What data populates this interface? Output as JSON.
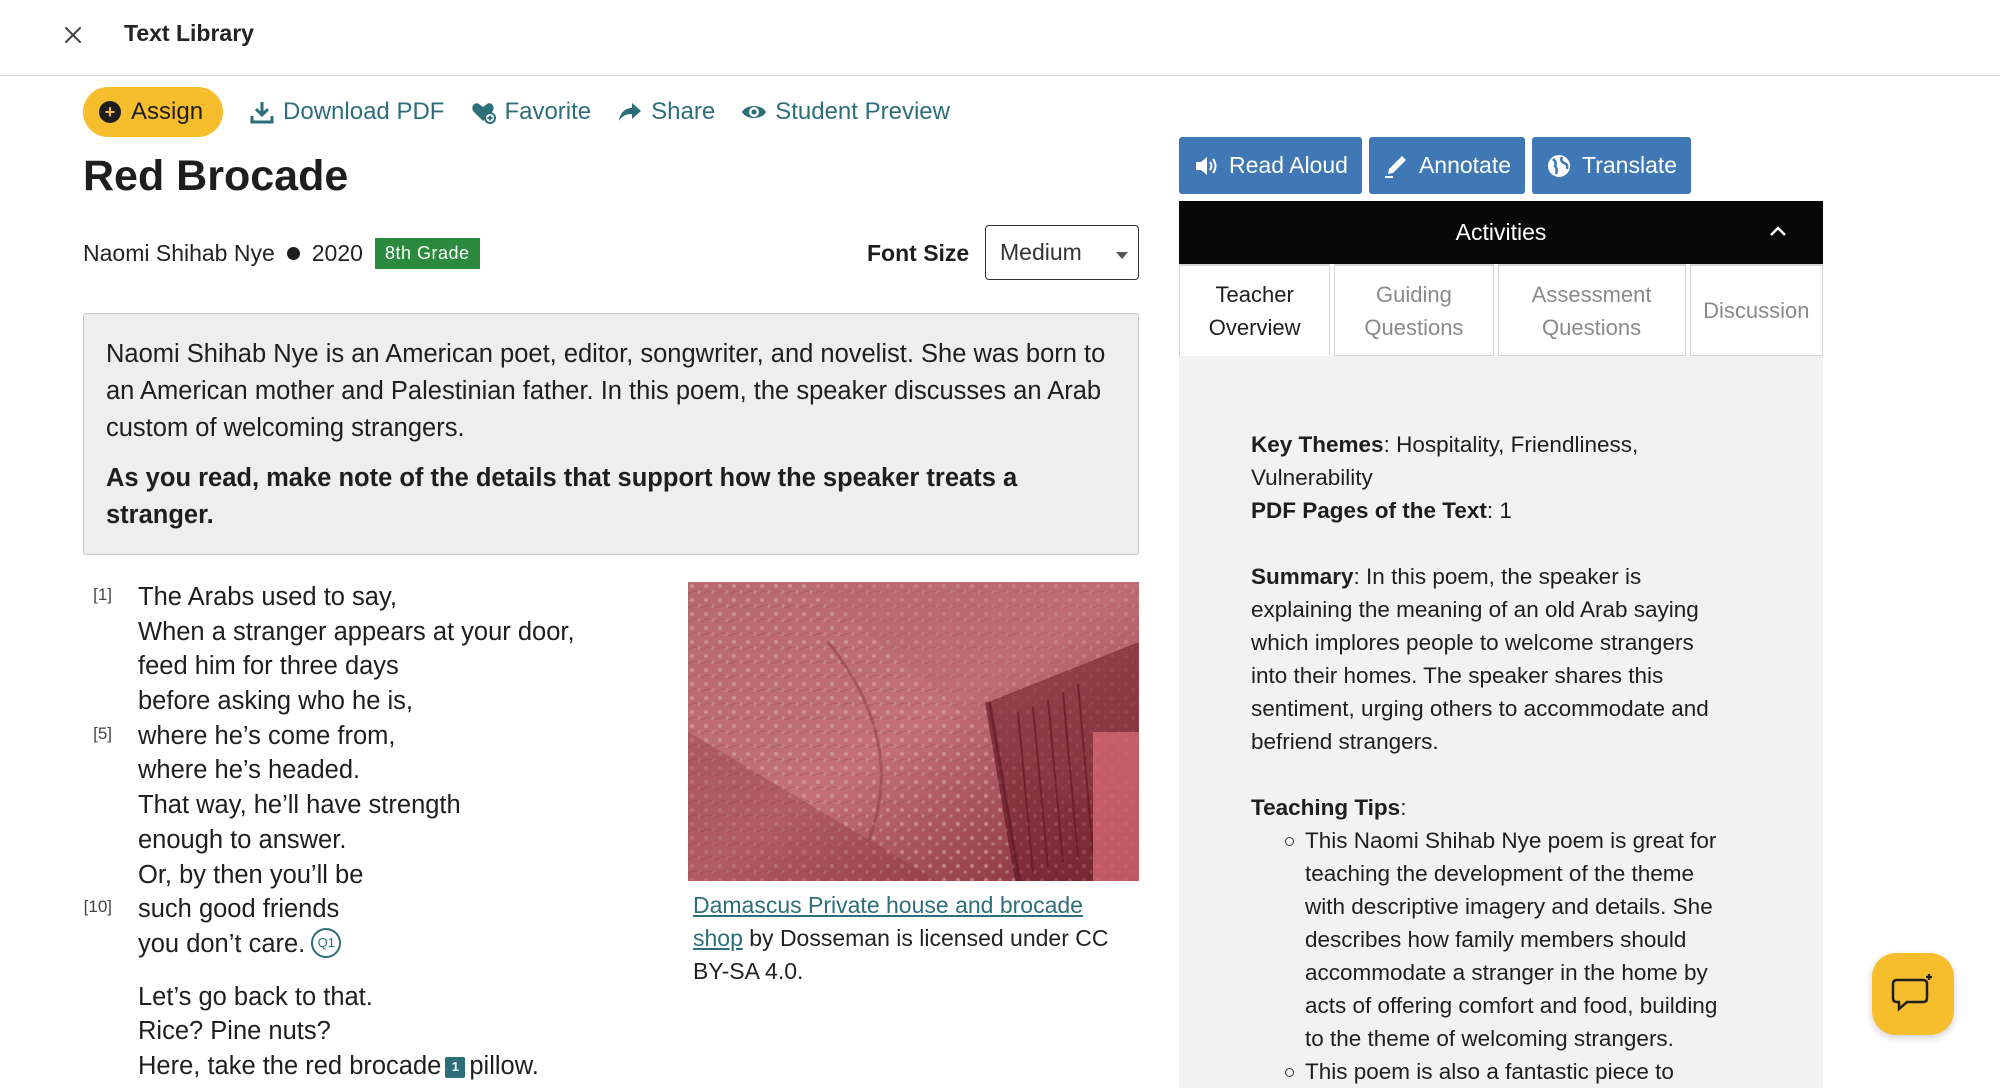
{
  "header": {
    "title": "Text Library"
  },
  "toolbar": {
    "assign": "Assign",
    "download_pdf": "Download PDF",
    "favorite": "Favorite",
    "share": "Share",
    "student_preview": "Student Preview"
  },
  "text": {
    "title": "Red Brocade",
    "author": "Naomi Shihab Nye",
    "year": "2020",
    "grade": "8th Grade",
    "font_size_label": "Font Size",
    "font_size_value": "Medium"
  },
  "intro": {
    "paragraph": "Naomi Shihab Nye is an American poet, editor, songwriter, and novelist. She was born to an American mother and Palestinian father. In this poem, the speaker discusses an Arab custom of welcoming strangers.",
    "instruction": "As you read, make note of the details that support how the speaker treats a stranger."
  },
  "poem": {
    "lines": [
      {
        "num": "[1]",
        "text": "The Arabs used to say,"
      },
      {
        "num": "",
        "text": "When a stranger appears at your door,"
      },
      {
        "num": "",
        "text": "feed him for three days"
      },
      {
        "num": "",
        "text": "before asking who he is,"
      },
      {
        "num": "[5]",
        "text": "where he’s come from,"
      },
      {
        "num": "",
        "text": "where he’s headed."
      },
      {
        "num": "",
        "text": "That way, he’ll have strength"
      },
      {
        "num": "",
        "text": "enough to answer."
      },
      {
        "num": "",
        "text": "Or, by then you’ll be"
      },
      {
        "num": "[10]",
        "text": "such good friends"
      },
      {
        "num": "",
        "text": "you don’t care."
      }
    ],
    "q_marker": "Q1",
    "stanza2": [
      "Let’s go back to that.",
      "Rice? Pine nuts?",
      "Here, take the red brocade"
    ],
    "note_marker": "1",
    "last_line_tail": "pillow."
  },
  "image": {
    "caption_link": "Damascus Private house and brocade shop",
    "caption_rest": " by Dosseman is licensed under CC BY-SA 4.0."
  },
  "actions": {
    "read_aloud": "Read Aloud",
    "annotate": "Annotate",
    "translate": "Translate"
  },
  "activities": {
    "title": "Activities",
    "tabs": [
      {
        "line1": "Teacher",
        "line2": "Overview"
      },
      {
        "line1": "Guiding",
        "line2": "Questions"
      },
      {
        "line1": "Assessment",
        "line2": "Questions"
      },
      {
        "line1": "Discussion",
        "line2": ""
      }
    ],
    "key_themes_label": "Key Themes",
    "key_themes": ": Hospitality, Friendliness, Vulnerability",
    "pdf_pages_label": "PDF Pages of the Text",
    "pdf_pages": ": 1",
    "summary_label": "Summary",
    "summary": ": In this poem, the speaker is explaining the meaning of an old Arab saying which implores people to welcome strangers into their homes. The speaker shares this sentiment, urging others to accommodate and befriend strangers.",
    "tips_label": "Teaching Tips",
    "tips_colon": ":",
    "tips": [
      "This Naomi Shihab Nye poem is great for teaching the development of the theme with descriptive imagery and details. She describes how family members should accommodate a stranger in the home by acts of offering comfort and food, building to the theme of welcoming strangers.",
      "This poem is also a fantastic piece to"
    ]
  },
  "colors": {
    "accent_teal": "#2c6e7a",
    "assign_yellow": "#f6bd2d",
    "action_blue": "#3f78b4",
    "grade_green": "#2b8a3e"
  },
  "icons": {
    "close": "close-icon",
    "assign": "plus-circle-icon",
    "download": "download-icon",
    "favorite": "heart-icon",
    "share": "share-icon",
    "preview": "eye-icon",
    "read_aloud": "speaker-icon",
    "annotate": "pen-icon",
    "translate": "globe-icon",
    "collapse": "chevron-up-icon",
    "chat": "chat-icon"
  }
}
